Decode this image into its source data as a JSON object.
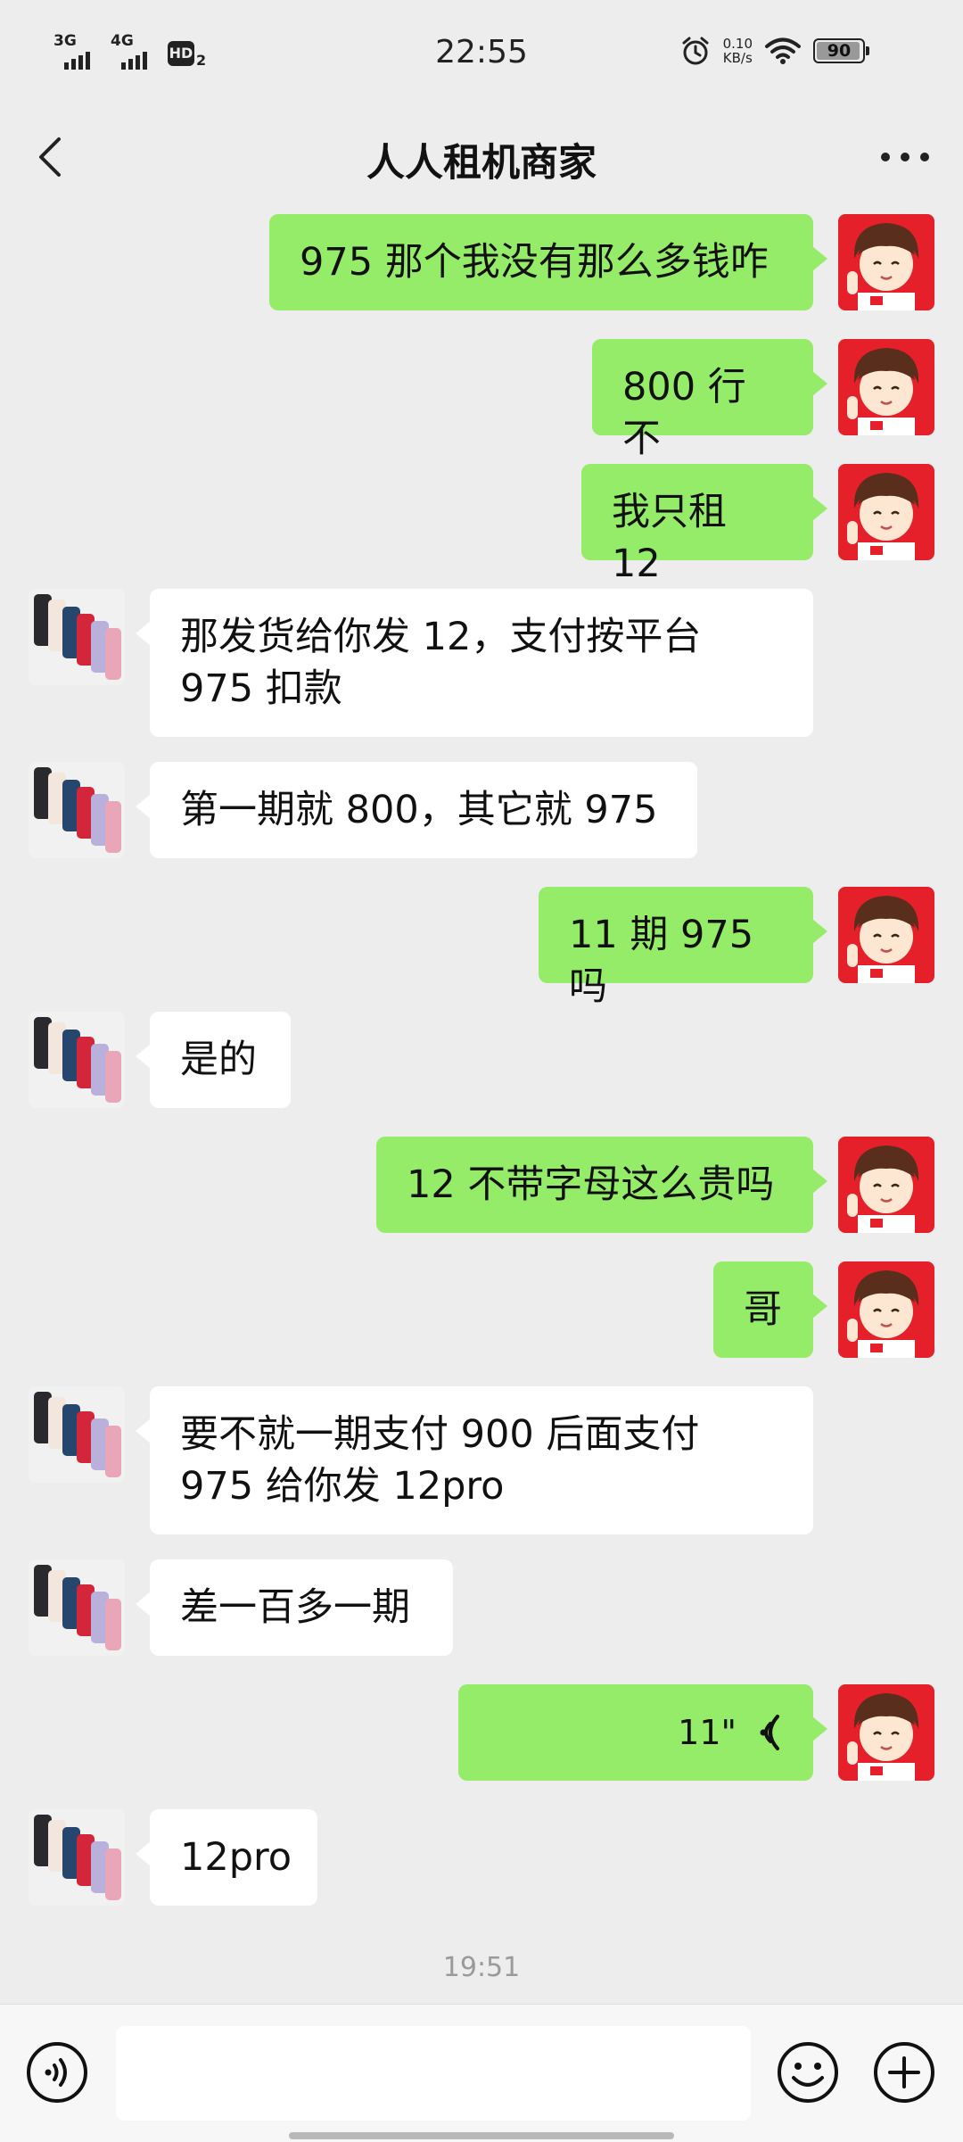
{
  "status_bar": {
    "net1": "3G",
    "net2": "4G",
    "hd": "HD",
    "hd_sub": "2",
    "time": "22:55",
    "speed_value": "0.10",
    "speed_unit": "KB/s",
    "battery": "90"
  },
  "header": {
    "title": "人人租机商家"
  },
  "messages": [
    {
      "side": "right",
      "text": "975 那个我没有那么多钱咋"
    },
    {
      "side": "right",
      "text": "800 行不"
    },
    {
      "side": "right",
      "text": "我只租 12"
    },
    {
      "side": "left",
      "text": "那发货给你发 12，支付按平台 975 扣款"
    },
    {
      "side": "left",
      "text": "第一期就 800，其它就 975"
    },
    {
      "side": "right",
      "text": "11 期 975 吗"
    },
    {
      "side": "left",
      "text": "是的"
    },
    {
      "side": "right",
      "text": "12 不带字母这么贵吗"
    },
    {
      "side": "right",
      "text": "哥"
    },
    {
      "side": "left",
      "text": "要不就一期支付 900 后面支付 975 给你发 12pro"
    },
    {
      "side": "left",
      "text": "差一百多一期"
    },
    {
      "side": "right",
      "type": "voice",
      "duration": "11\""
    },
    {
      "side": "left",
      "text": "12pro"
    }
  ],
  "time_separator": "19:51",
  "input": {
    "value": "",
    "placeholder": ""
  },
  "icons": {
    "back": "chevron-left-icon",
    "more": "more-dots-icon",
    "voice": "voice-input-icon",
    "emoji": "emoji-icon",
    "plus": "plus-icon"
  },
  "colors": {
    "sent_bubble": "#95ec69",
    "received_bubble": "#ffffff",
    "background": "#ededed"
  }
}
